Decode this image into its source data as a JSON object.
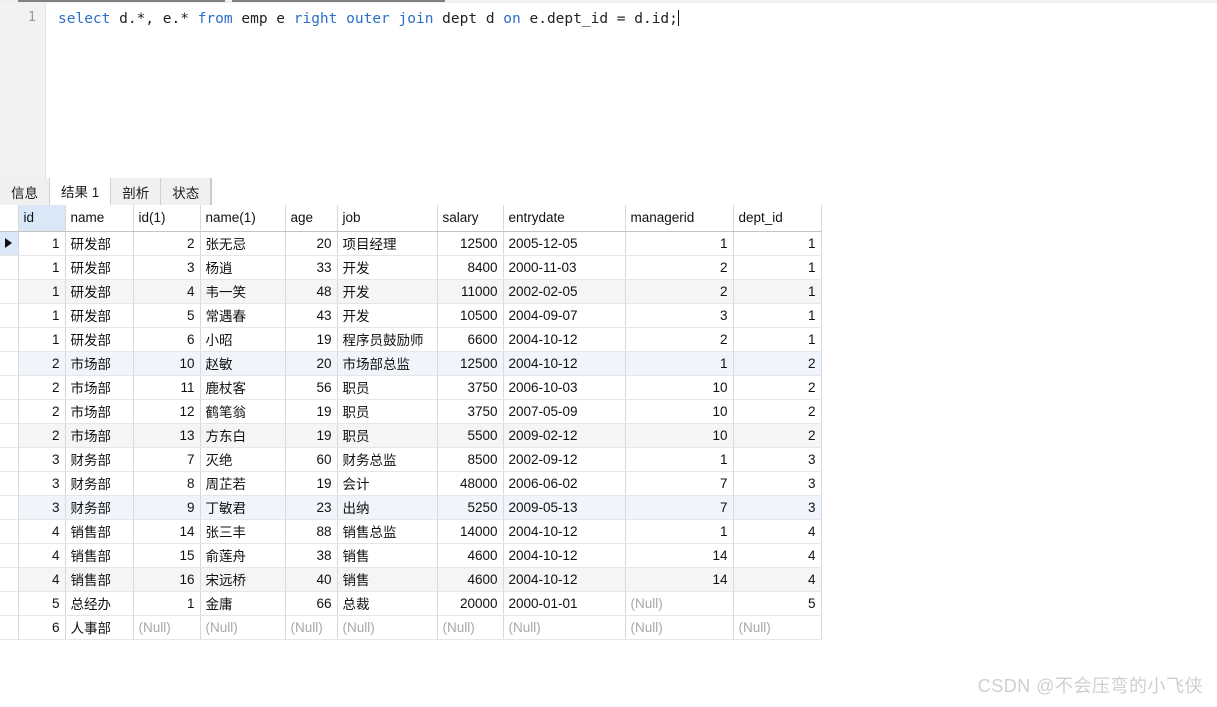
{
  "editor": {
    "line_number": "1",
    "sql_tokens": [
      {
        "text": "select",
        "kw": true
      },
      {
        "text": " d.*, e.* ",
        "kw": false
      },
      {
        "text": "from",
        "kw": true
      },
      {
        "text": " emp e ",
        "kw": false
      },
      {
        "text": "right",
        "kw": true
      },
      {
        "text": " ",
        "kw": false
      },
      {
        "text": "outer",
        "kw": true
      },
      {
        "text": " ",
        "kw": false
      },
      {
        "text": "join",
        "kw": true
      },
      {
        "text": " dept d ",
        "kw": false
      },
      {
        "text": "on",
        "kw": true
      },
      {
        "text": " e.dept_id = d.id;",
        "kw": false
      }
    ],
    "sql_text": "select d.*, e.* from emp e right outer join dept d on e.dept_id = d.id;"
  },
  "tabs": [
    {
      "label": "信息",
      "active": false
    },
    {
      "label": "结果 1",
      "active": true
    },
    {
      "label": "剖析",
      "active": false
    },
    {
      "label": "状态",
      "active": false
    }
  ],
  "grid": {
    "columns": [
      {
        "key": "id",
        "label": "id",
        "align": "num",
        "cls": "c-id",
        "selected": true
      },
      {
        "key": "name",
        "label": "name",
        "align": "txt",
        "cls": "c-name",
        "selected": false
      },
      {
        "key": "id1",
        "label": "id(1)",
        "align": "num",
        "cls": "c-id1",
        "selected": false
      },
      {
        "key": "name1",
        "label": "name(1)",
        "align": "txt",
        "cls": "c-name1",
        "selected": false
      },
      {
        "key": "age",
        "label": "age",
        "align": "num",
        "cls": "c-age",
        "selected": false
      },
      {
        "key": "job",
        "label": "job",
        "align": "txt",
        "cls": "c-job",
        "selected": false
      },
      {
        "key": "salary",
        "label": "salary",
        "align": "num",
        "cls": "c-salary",
        "selected": false
      },
      {
        "key": "entrydate",
        "label": "entrydate",
        "align": "txt",
        "cls": "c-entry",
        "selected": false
      },
      {
        "key": "managerid",
        "label": "managerid",
        "align": "num",
        "cls": "c-mgr",
        "selected": false
      },
      {
        "key": "dept_id",
        "label": "dept_id",
        "align": "num",
        "cls": "c-dept",
        "selected": false
      }
    ],
    "null_label": "(Null)",
    "rows": [
      {
        "marked": true,
        "stripe": "none",
        "cells": [
          "1",
          "研发部",
          "2",
          "张无忌",
          "20",
          "项目经理",
          "12500",
          "2005-12-05",
          "1",
          "1"
        ]
      },
      {
        "marked": false,
        "stripe": "none",
        "cells": [
          "1",
          "研发部",
          "3",
          "杨逍",
          "33",
          "开发",
          "8400",
          "2000-11-03",
          "2",
          "1"
        ]
      },
      {
        "marked": false,
        "stripe": "gray",
        "cells": [
          "1",
          "研发部",
          "4",
          "韦一笑",
          "48",
          "开发",
          "11000",
          "2002-02-05",
          "2",
          "1"
        ]
      },
      {
        "marked": false,
        "stripe": "none",
        "cells": [
          "1",
          "研发部",
          "5",
          "常遇春",
          "43",
          "开发",
          "10500",
          "2004-09-07",
          "3",
          "1"
        ]
      },
      {
        "marked": false,
        "stripe": "none",
        "cells": [
          "1",
          "研发部",
          "6",
          "小昭",
          "19",
          "程序员鼓励师",
          "6600",
          "2004-10-12",
          "2",
          "1"
        ]
      },
      {
        "marked": false,
        "stripe": "blue",
        "cells": [
          "2",
          "市场部",
          "10",
          "赵敏",
          "20",
          "市场部总监",
          "12500",
          "2004-10-12",
          "1",
          "2"
        ]
      },
      {
        "marked": false,
        "stripe": "none",
        "cells": [
          "2",
          "市场部",
          "11",
          "鹿杖客",
          "56",
          "职员",
          "3750",
          "2006-10-03",
          "10",
          "2"
        ]
      },
      {
        "marked": false,
        "stripe": "none",
        "cells": [
          "2",
          "市场部",
          "12",
          "鹤笔翁",
          "19",
          "职员",
          "3750",
          "2007-05-09",
          "10",
          "2"
        ]
      },
      {
        "marked": false,
        "stripe": "gray",
        "cells": [
          "2",
          "市场部",
          "13",
          "方东白",
          "19",
          "职员",
          "5500",
          "2009-02-12",
          "10",
          "2"
        ]
      },
      {
        "marked": false,
        "stripe": "none",
        "cells": [
          "3",
          "财务部",
          "7",
          "灭绝",
          "60",
          "财务总监",
          "8500",
          "2002-09-12",
          "1",
          "3"
        ]
      },
      {
        "marked": false,
        "stripe": "none",
        "cells": [
          "3",
          "财务部",
          "8",
          "周芷若",
          "19",
          "会计",
          "48000",
          "2006-06-02",
          "7",
          "3"
        ]
      },
      {
        "marked": false,
        "stripe": "blue",
        "cells": [
          "3",
          "财务部",
          "9",
          "丁敏君",
          "23",
          "出纳",
          "5250",
          "2009-05-13",
          "7",
          "3"
        ]
      },
      {
        "marked": false,
        "stripe": "none",
        "cells": [
          "4",
          "销售部",
          "14",
          "张三丰",
          "88",
          "销售总监",
          "14000",
          "2004-10-12",
          "1",
          "4"
        ]
      },
      {
        "marked": false,
        "stripe": "none",
        "cells": [
          "4",
          "销售部",
          "15",
          "俞莲舟",
          "38",
          "销售",
          "4600",
          "2004-10-12",
          "14",
          "4"
        ]
      },
      {
        "marked": false,
        "stripe": "gray",
        "cells": [
          "4",
          "销售部",
          "16",
          "宋远桥",
          "40",
          "销售",
          "4600",
          "2004-10-12",
          "14",
          "4"
        ]
      },
      {
        "marked": false,
        "stripe": "none",
        "cells": [
          "5",
          "总经办",
          "1",
          "金庸",
          "66",
          "总裁",
          "20000",
          "2000-01-01",
          "(Null)",
          "5"
        ]
      },
      {
        "marked": false,
        "stripe": "none",
        "cells": [
          "6",
          "人事部",
          "(Null)",
          "(Null)",
          "(Null)",
          "(Null)",
          "(Null)",
          "(Null)",
          "(Null)",
          "(Null)"
        ]
      }
    ]
  },
  "watermark": {
    "text": "CSDN @不会压弯的小飞侠"
  }
}
